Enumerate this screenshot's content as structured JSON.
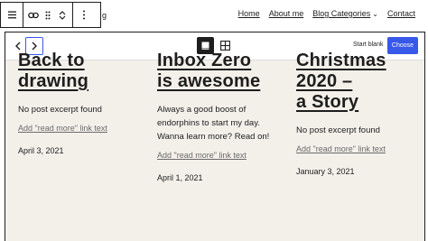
{
  "toolbar": {
    "trunc_letter": "g"
  },
  "site_nav": {
    "items": [
      "Home",
      "About me",
      "Blog Categories",
      "Contact"
    ]
  },
  "carousel": {
    "start_blank_label": "Start blank",
    "choose_label": "Choose",
    "accent_color": "#3858e9"
  },
  "posts": [
    {
      "title_lines": [
        "Back to",
        "drawing"
      ],
      "excerpt": "No post excerpt found",
      "read_more": "Add \"read more\" link text",
      "date": "April 3, 2021"
    },
    {
      "title_lines": [
        "Inbox Zero",
        "is awesome"
      ],
      "excerpt": "Always a good boost of endorphins to start my day. Wanna learn more? Read on!",
      "read_more": "Add \"read more\" link text",
      "date": "April 1, 2021"
    },
    {
      "title_lines": [
        "Christmas",
        "2020 –",
        "a Story"
      ],
      "excerpt": "No post excerpt found",
      "read_more": "Add \"read more\" link text",
      "date": "January 3, 2021"
    }
  ],
  "icons": {
    "block_type": "hamburger-icon",
    "link": "link-icon",
    "drag": "drag-handle-icon",
    "move_up": "chevron-up-icon",
    "move_down": "chevron-down-icon",
    "more": "more-vertical-icon",
    "prev": "chevron-left-icon",
    "next": "chevron-right-icon",
    "single_view": "square-icon",
    "grid_view": "grid-icon"
  }
}
